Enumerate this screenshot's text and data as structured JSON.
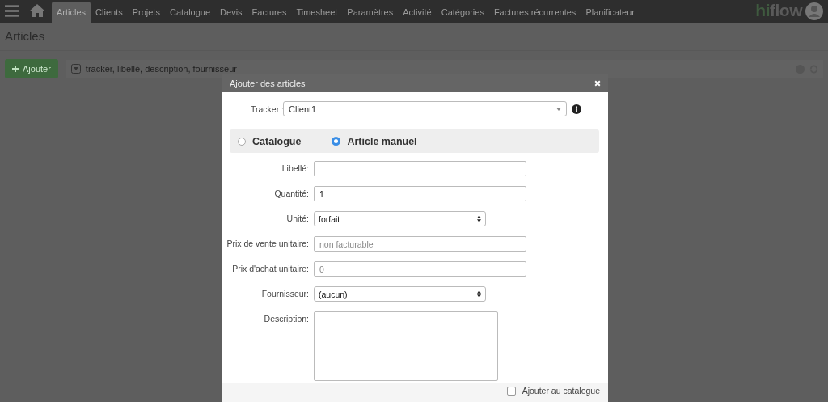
{
  "nav": {
    "tabs": [
      {
        "label": "Articles",
        "selected": true
      },
      {
        "label": "Clients",
        "selected": false
      },
      {
        "label": "Projets",
        "selected": false
      },
      {
        "label": "Catalogue",
        "selected": false
      },
      {
        "label": "Devis",
        "selected": false
      },
      {
        "label": "Factures",
        "selected": false
      },
      {
        "label": "Timesheet",
        "selected": false
      },
      {
        "label": "Paramètres",
        "selected": false
      },
      {
        "label": "Activité",
        "selected": false
      },
      {
        "label": "Catégories",
        "selected": false
      },
      {
        "label": "Factures récurrentes",
        "selected": false
      },
      {
        "label": "Planificateur",
        "selected": false
      }
    ],
    "logo_hi": "hi",
    "logo_flow": "flow"
  },
  "page": {
    "title": "Articles",
    "add_button": "Ajouter",
    "search_placeholder": "tracker, libellé, description, fournisseur"
  },
  "modal": {
    "title": "Ajouter des articles",
    "tracker": {
      "label": "Tracker :",
      "value": "Client1"
    },
    "modes": [
      {
        "label": "Catalogue",
        "selected": false
      },
      {
        "label": "Article manuel",
        "selected": true
      }
    ],
    "fields": [
      {
        "kind": "text",
        "label": "Libellé:"
      },
      {
        "kind": "text",
        "label": "Quantité:",
        "value": "1"
      },
      {
        "kind": "select",
        "label": "Unité:",
        "value": "forfait"
      },
      {
        "kind": "text",
        "label": "Prix de vente unitaire:",
        "placeholder": "non facturable"
      },
      {
        "kind": "text",
        "label": "Prix d'achat unitaire:",
        "placeholder": "0"
      },
      {
        "kind": "select",
        "label": "Fournisseur:",
        "value": "(aucun)"
      },
      {
        "kind": "textarea",
        "label": "Description:"
      }
    ],
    "catalogue_checkbox": {
      "label": "Ajouter au catalogue",
      "checked": false
    }
  }
}
